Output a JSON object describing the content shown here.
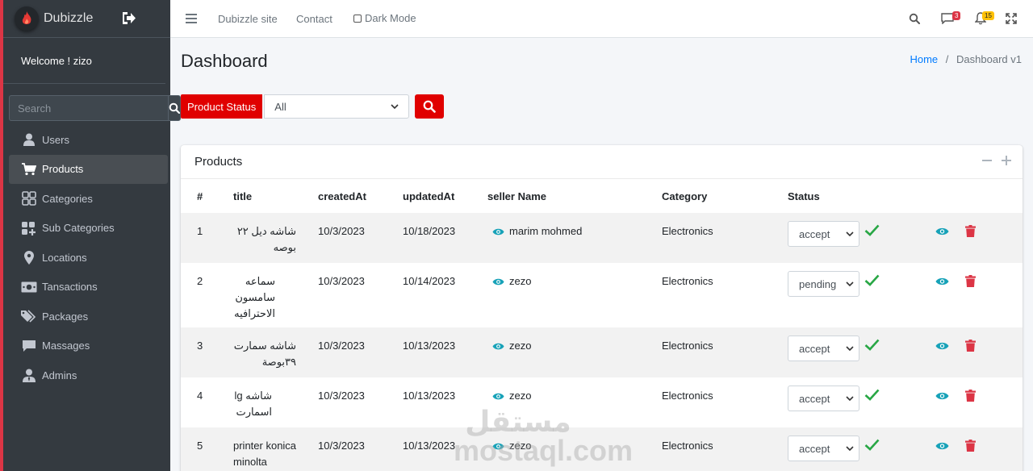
{
  "sidebar": {
    "brand": "Dubizzle",
    "welcome": "Welcome ! zizo",
    "search_placeholder": "Search",
    "items": [
      {
        "label": "Users",
        "icon": "user-icon",
        "active": false
      },
      {
        "label": "Products",
        "icon": "cart-icon",
        "active": true
      },
      {
        "label": "Categories",
        "icon": "grid-icon",
        "active": false
      },
      {
        "label": "Sub Categories",
        "icon": "grid-plus-icon",
        "active": false
      },
      {
        "label": "Locations",
        "icon": "map-marker-icon",
        "active": false
      },
      {
        "label": "Tansactions",
        "icon": "money-icon",
        "active": false
      },
      {
        "label": "Packages",
        "icon": "tags-icon",
        "active": false
      },
      {
        "label": "Massages",
        "icon": "comment-icon",
        "active": false
      },
      {
        "label": "Admins",
        "icon": "user-tie-icon",
        "active": false
      }
    ]
  },
  "navbar": {
    "links": [
      "Dubizzle site",
      "Contact"
    ],
    "dark_mode_label": "Dark Mode",
    "messages_badge": "3",
    "notifications_badge": "15"
  },
  "page": {
    "title": "Dashboard",
    "breadcrumb_home": "Home",
    "breadcrumb_sep": "/",
    "breadcrumb_current": "Dashboard v1"
  },
  "filter": {
    "label": "Product Status",
    "selected": "All"
  },
  "products": {
    "card_title": "Products",
    "columns": [
      "#",
      "title",
      "createdAt",
      "updatedAt",
      "seller Name",
      "Category",
      "Status"
    ],
    "rows": [
      {
        "num": "1",
        "title": "شاشه ديل ٢٢ بوصه",
        "created": "10/3/2023",
        "updated": "10/18/2023",
        "seller": "marim mohmed",
        "category": "Electronics",
        "status": "accept"
      },
      {
        "num": "2",
        "title": "سماعه سامسون الاحترافيه",
        "created": "10/3/2023",
        "updated": "10/14/2023",
        "seller": "zezo",
        "category": "Electronics",
        "status": "pending"
      },
      {
        "num": "3",
        "title": "شاشه سمارت ٣٩بوصة",
        "created": "10/3/2023",
        "updated": "10/13/2023",
        "seller": "zezo",
        "category": "Electronics",
        "status": "accept"
      },
      {
        "num": "4",
        "title": "شاشه lg اسمارت",
        "created": "10/3/2023",
        "updated": "10/13/2023",
        "seller": "zezo",
        "category": "Electronics",
        "status": "accept"
      },
      {
        "num": "5",
        "title": "printer konica minolta",
        "created": "10/3/2023",
        "updated": "10/13/2023",
        "seller": "zezo",
        "category": "Electronics",
        "status": "accept"
      }
    ]
  },
  "watermark": "مستقل mostaql.com",
  "colors": {
    "sidebar_bg": "#343a40",
    "accent_red": "#e00000",
    "teal": "#17a2b8",
    "green": "#28a745",
    "danger": "#dc3545",
    "link_blue": "#007bff"
  }
}
